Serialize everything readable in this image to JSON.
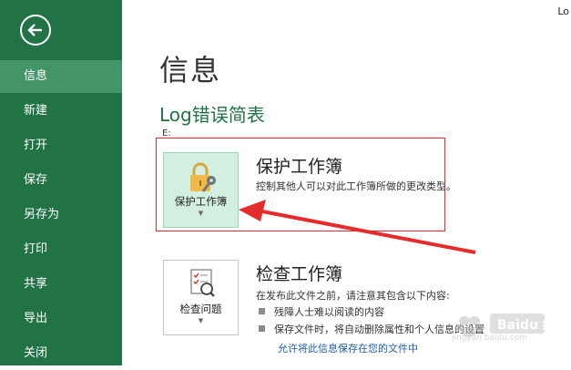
{
  "window": {
    "corner_text": "Lo"
  },
  "sidebar": {
    "items": [
      {
        "label": "信息",
        "active": true
      },
      {
        "label": "新建"
      },
      {
        "label": "打开"
      },
      {
        "label": "保存"
      },
      {
        "label": "另存为"
      },
      {
        "label": "打印"
      },
      {
        "label": "共享"
      },
      {
        "label": "导出"
      },
      {
        "label": "关闭"
      }
    ]
  },
  "main": {
    "title": "信息",
    "doc_name": "Log错误简表",
    "doc_path": "E:",
    "protect": {
      "tile_label": "保护工作簿",
      "heading": "保护工作簿",
      "description": "控制其他人可以对此工作簿所做的更改类型。"
    },
    "inspect": {
      "tile_label": "检查问题",
      "heading": "检查工作簿",
      "description": "在发布此文件之前，请注意其包含以下内容:",
      "bullets": [
        "残障人士难以阅读的内容",
        "保存文件时，将自动删除属性和个人信息的设置"
      ],
      "link": "允许将此信息保存在您的文件中"
    }
  },
  "colors": {
    "sidebar_bg": "#217346",
    "sidebar_active": "#439467",
    "accent_green": "#217346",
    "annotation_red": "#e52b2b",
    "link_blue": "#1e5fb3"
  },
  "watermark": {
    "text": "jingyan.baidu.com",
    "logo_text": "Baidu 经验"
  }
}
